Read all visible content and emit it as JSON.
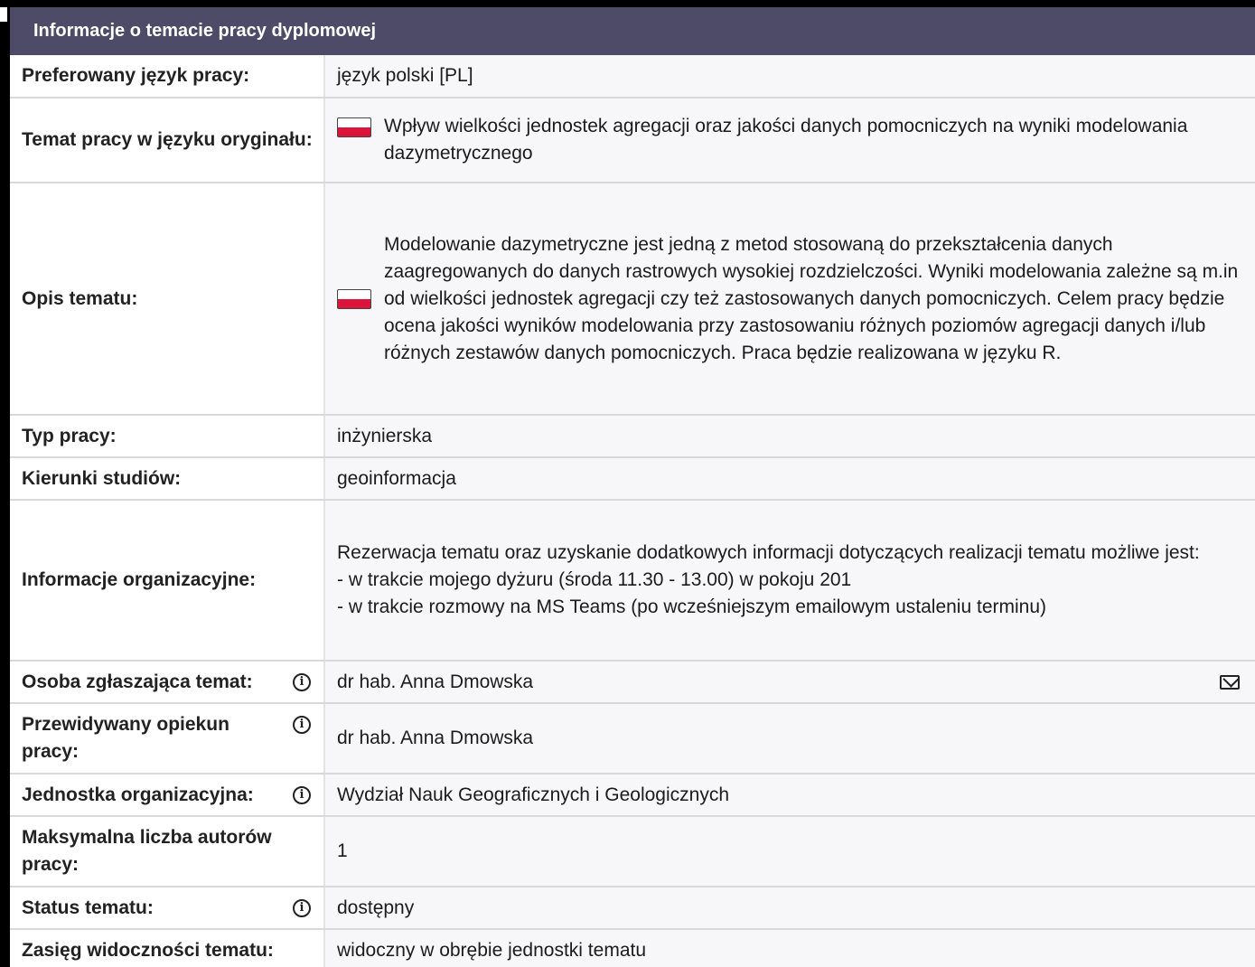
{
  "header": {
    "title": "Informacje o temacie pracy dyplomowej"
  },
  "rows": {
    "language": {
      "label": "Preferowany język pracy:",
      "value": "język polski [PL]"
    },
    "topic": {
      "label": "Temat pracy w języku oryginału:",
      "value": "Wpływ wielkości jednostek agregacji oraz jakości danych pomocniczych na wyniki modelowania dazymetrycznego",
      "flag_icon": "poland-flag-icon"
    },
    "description": {
      "label": "Opis tematu:",
      "value": "Modelowanie dazymetryczne jest jedną z metod stosowaną do przekształcenia danych zaagregowanych do danych rastrowych wysokiej rozdzielczości. Wyniki modelowania zależne są m.in od wielkości jednostek agregacji czy też zastosowanych danych pomocniczych. Celem pracy będzie ocena jakości wyników modelowania przy zastosowaniu różnych poziomów agregacji danych i/lub różnych zestawów danych pomocniczych. Praca będzie realizowana w języku R.",
      "flag_icon": "poland-flag-icon"
    },
    "type": {
      "label": "Typ pracy:",
      "value": "inżynierska"
    },
    "fields": {
      "label": "Kierunki studiów:",
      "value": "geoinformacja"
    },
    "org_info": {
      "label": "Informacje organizacyjne:",
      "lines": [
        "Rezerwacja tematu oraz uzyskanie dodatkowych informacji dotyczących realizacji tematu możliwe jest:",
        "- w trakcie mojego dyżuru (środa 11.30 - 13.00) w pokoju 201",
        "- w trakcie rozmowy na MS Teams (po wcześniejszym emailowym ustaleniu terminu)"
      ]
    },
    "submitter": {
      "label": "Osoba zgłaszająca temat:",
      "value": "dr hab. Anna Dmowska",
      "icon": "info-icon",
      "action_icon": "mail-icon"
    },
    "supervisor": {
      "label": "Przewidywany opiekun pracy:",
      "value": "dr hab. Anna Dmowska",
      "icon": "info-icon"
    },
    "unit": {
      "label": "Jednostka organizacyjna:",
      "value": "Wydział Nauk Geograficznych i Geologicznych",
      "icon": "info-icon"
    },
    "max_authors": {
      "label": "Maksymalna liczba autorów pracy:",
      "value": "1"
    },
    "status": {
      "label": "Status tematu:",
      "value": "dostępny",
      "icon": "info-icon"
    },
    "visibility": {
      "label": "Zasięg widoczności tematu:",
      "value": "widoczny w obrębie jednostki tematu"
    }
  },
  "info_glyph": "i",
  "colors": {
    "header_bg": "#4d4b67",
    "flag_red": "#dc143c",
    "value_bg": "#f7f7f9"
  }
}
